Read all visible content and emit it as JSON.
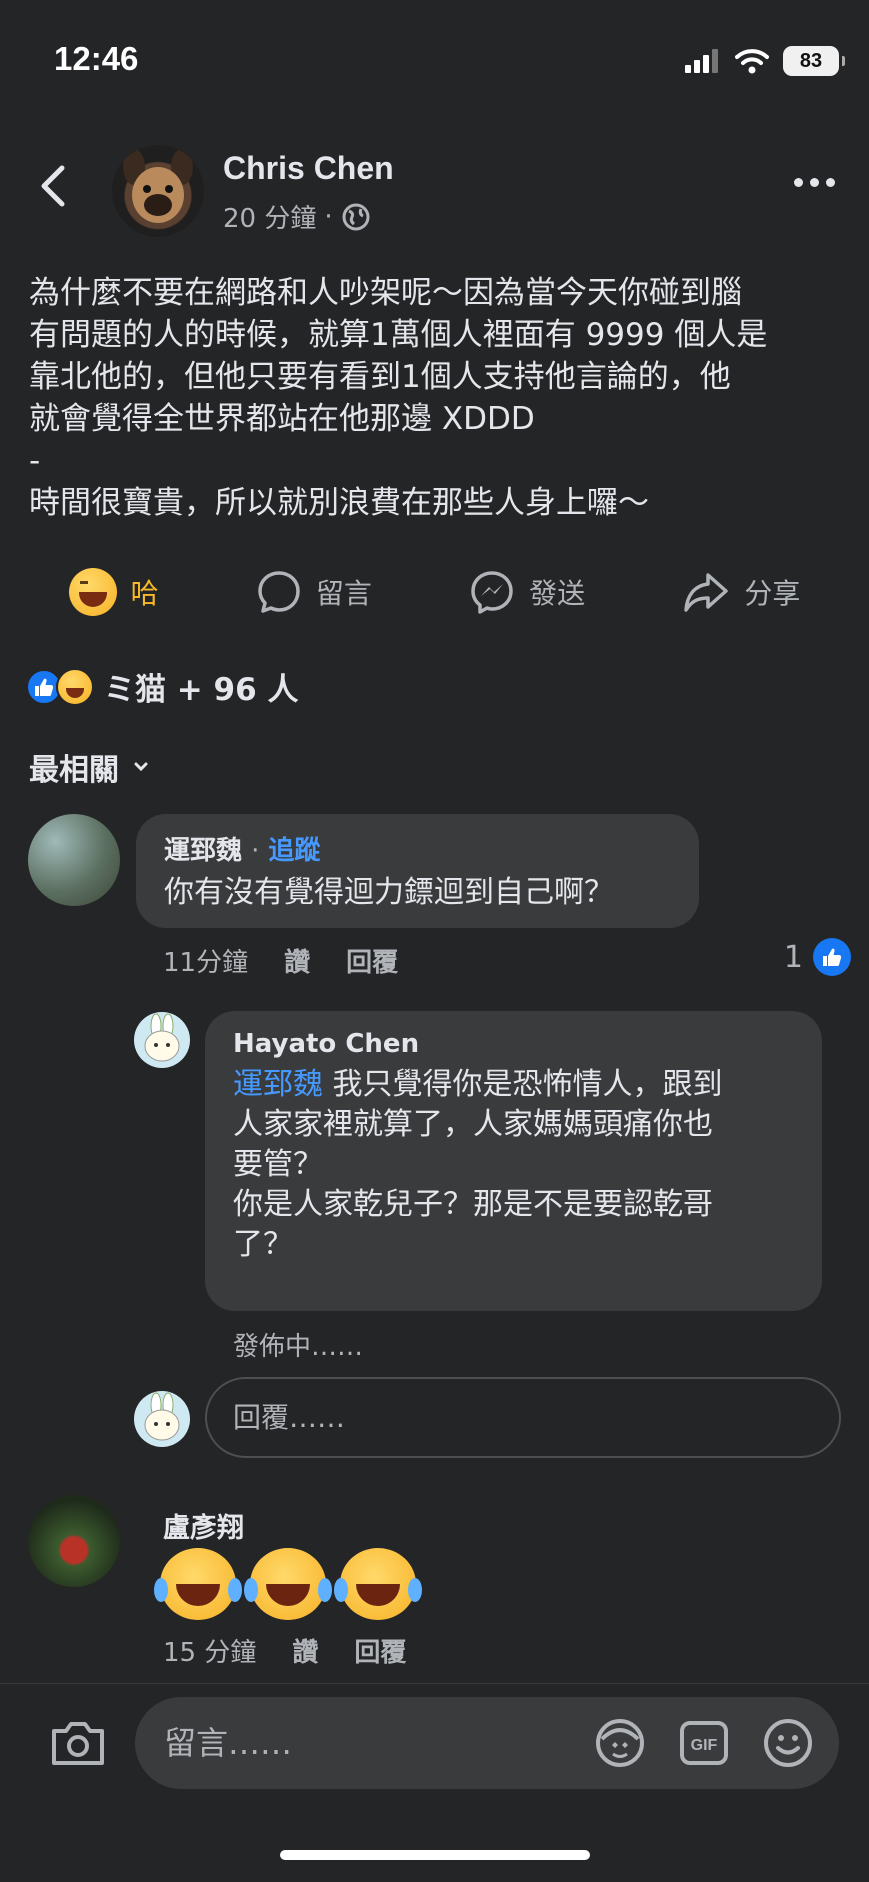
{
  "status_bar": {
    "time": "12:46",
    "battery": "83"
  },
  "header": {
    "author": "Chris Chen",
    "time_ago": "20 分鐘",
    "separator": "·"
  },
  "post": {
    "text": "為什麼不要在網路和人吵架呢～因為當今天你碰到腦\n有問題的人的時候，就算1萬個人裡面有 9999 個人是\n靠北他的，但他只要有看到1個人支持他言論的，他\n就會覺得全世界都站在他那邊 XDDD\n-\n時間很寶貴，所以就別浪費在那些人身上囉～"
  },
  "actions": {
    "haha": "哈",
    "comment": "留言",
    "send": "發送",
    "share": "分享"
  },
  "reactions_summary": "ミ猫 + 96 人",
  "sort_label": "最相關",
  "comments": [
    {
      "name": "運郅魏",
      "separator": "·",
      "follow": "追蹤",
      "text": "你有沒有覺得迴力鏢迴到自己啊？",
      "time": "11分鐘",
      "like": "讚",
      "reply": "回覆",
      "like_count": "1"
    },
    {
      "name": "Hayato Chen",
      "mention": "運郅魏",
      "text_line1": " 我只覺得你是恐怖情人，跟到",
      "text_rest": "人家家裡就算了，人家媽媽頭痛你也\n要管？\n你是人家乾兒子？那是不是要認乾哥\n了？",
      "status": "發佈中……"
    },
    {
      "name": "盧彥翔",
      "time": "15 分鐘",
      "like": "讚",
      "reply": "回覆"
    }
  ],
  "reply_placeholder": "回覆……",
  "composer_placeholder": "留言……",
  "icons": {
    "gif": "GIF"
  },
  "colors": {
    "background": "#242526",
    "bubble": "#3a3b3c",
    "link": "#4599ff",
    "haha": "#f7b928",
    "like": "#1877f2"
  }
}
